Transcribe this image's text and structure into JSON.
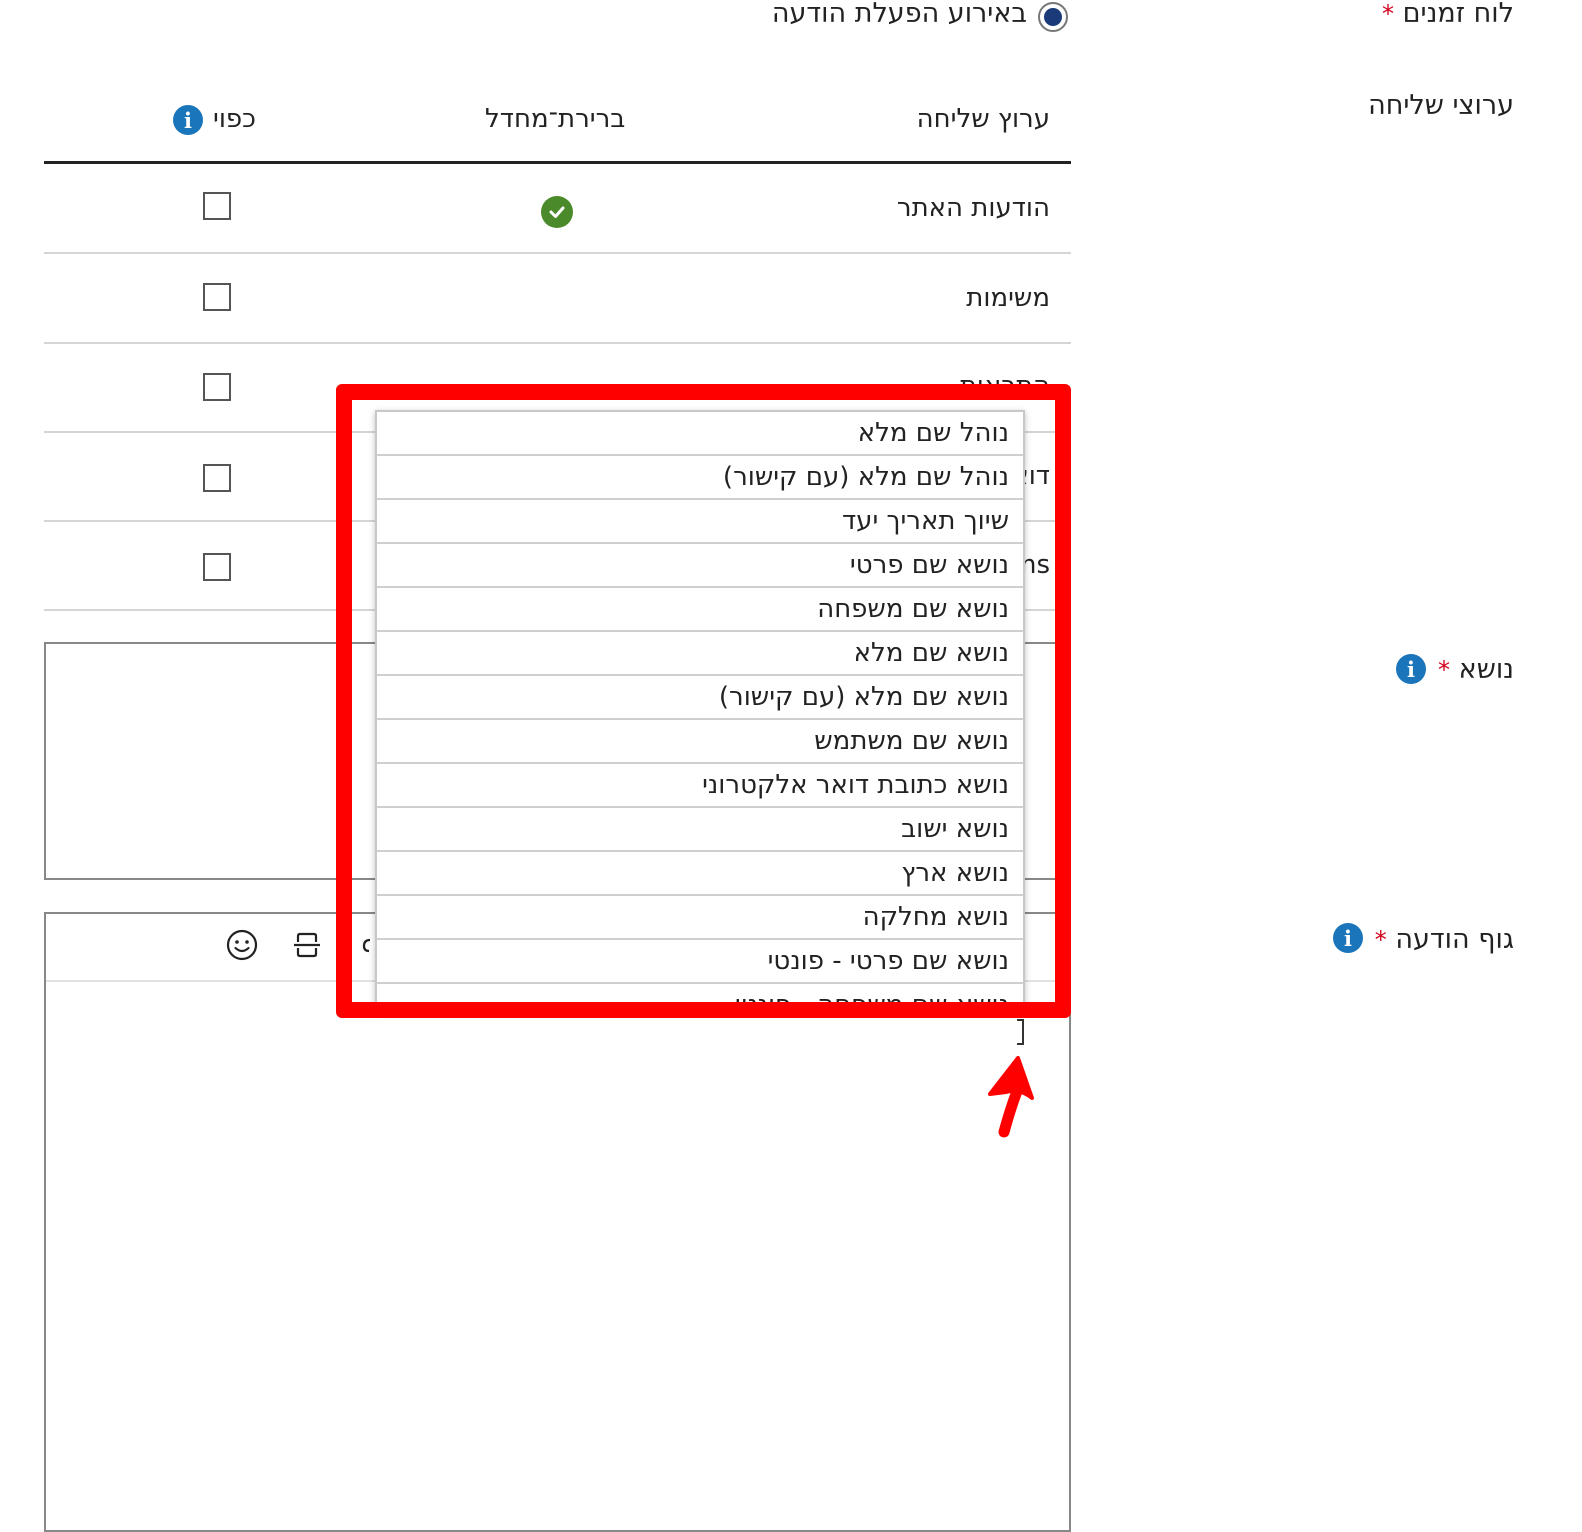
{
  "schedule": {
    "label": "לוח זמנים",
    "required": "*",
    "radio_label": "באירוע הפעלת הודעה"
  },
  "channels_section": {
    "label": "ערוצי שליחה"
  },
  "table": {
    "headers": {
      "channel": "ערוץ שליחה",
      "default": "ברירת־מחדל",
      "forced": "כפוי",
      "info": "i"
    },
    "rows": [
      {
        "name": "הודעות האתר",
        "is_default": true
      },
      {
        "name": "משימות",
        "is_default": false
      },
      {
        "name": "התראות",
        "is_default": false
      },
      {
        "name": "דואר",
        "is_default": false
      },
      {
        "name": "ms",
        "is_default": false
      }
    ]
  },
  "subject": {
    "label": "נושא",
    "required": "*",
    "info": "i"
  },
  "body": {
    "label": "גוף הודעה",
    "required": "*",
    "info": "i"
  },
  "dropdown": {
    "items": [
      "נוהל שם מלא",
      "נוהל שם מלא (עם קישור)",
      "שיוך תאריך יעד",
      "נושא שם פרטי",
      "נושא שם משפחה",
      "נושא שם מלא",
      "נושא שם מלא (עם קישור)",
      "נושא שם משתמש",
      "נושא כתובת דואר אלקטרוני",
      "נושא ישוב",
      "נושא ארץ",
      "נושא מחלקה",
      "נושא שם פרטי - פונטי",
      "נושא שם משפחה - פונטי"
    ]
  },
  "colors": {
    "accent": "#1b75bb",
    "highlight": "#ff0000",
    "check": "#4a8a2a",
    "required": "#d0021b"
  }
}
